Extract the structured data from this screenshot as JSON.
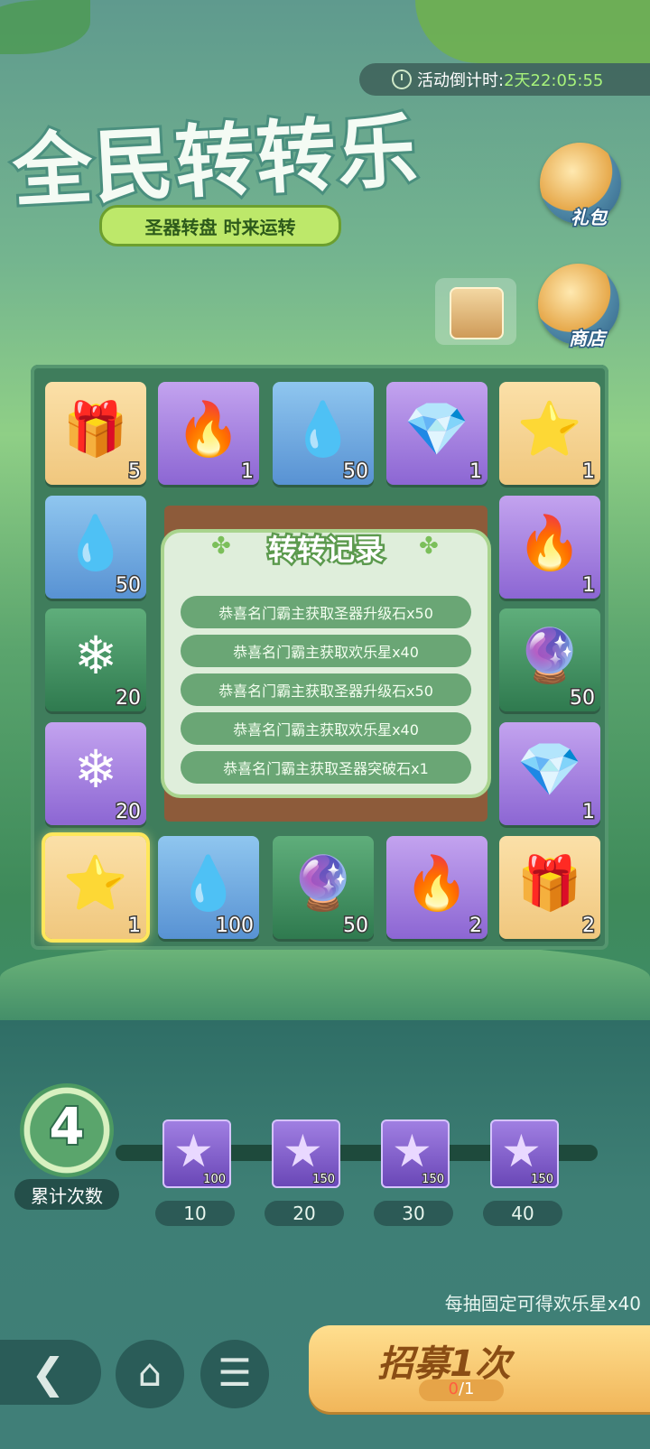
{
  "timer": {
    "label": "活动倒计时:",
    "value": "2天22:05:55",
    "icon": "clock-icon"
  },
  "title": {
    "main": "全民转转乐",
    "subtitle": "圣器转盘 时来运转"
  },
  "side_buttons": {
    "gift": "礼包",
    "shop": "商店"
  },
  "board": {
    "cells": [
      {
        "item": "chest",
        "icon": "🎁",
        "qty": "5",
        "color": "orange"
      },
      {
        "item": "fire-orb",
        "icon": "🔥",
        "qty": "1",
        "color": "purple"
      },
      {
        "item": "water-orb",
        "icon": "💧",
        "qty": "50",
        "color": "blue"
      },
      {
        "item": "red-crystal",
        "icon": "💎",
        "qty": "1",
        "color": "purple"
      },
      {
        "item": "star",
        "icon": "⭐",
        "qty": "1",
        "color": "orange"
      },
      {
        "item": "water-orb",
        "icon": "💧",
        "qty": "50",
        "color": "blue"
      },
      {
        "item": "fire-orb",
        "icon": "🔥",
        "qty": "1",
        "color": "purple"
      },
      {
        "item": "ice-shard",
        "icon": "❄",
        "qty": "20",
        "color": "green"
      },
      {
        "item": "purple-crystal",
        "icon": "🔮",
        "qty": "50",
        "color": "green"
      },
      {
        "item": "ice-shard",
        "icon": "❄",
        "qty": "20",
        "color": "purple"
      },
      {
        "item": "red-crystal",
        "icon": "💎",
        "qty": "1",
        "color": "purple"
      },
      {
        "item": "star",
        "icon": "⭐",
        "qty": "1",
        "color": "orange"
      },
      {
        "item": "water-orb",
        "icon": "💧",
        "qty": "100",
        "color": "blue"
      },
      {
        "item": "purple-crystal",
        "icon": "🔮",
        "qty": "50",
        "color": "green"
      },
      {
        "item": "fire-orb",
        "icon": "🔥",
        "qty": "2",
        "color": "purple"
      },
      {
        "item": "chest",
        "icon": "🎁",
        "qty": "2",
        "color": "orange"
      }
    ]
  },
  "record": {
    "title": "转转记录",
    "rows": [
      "恭喜名门霸主获取圣器升级石x50",
      "恭喜名门霸主获取欢乐星x40",
      "恭喜名门霸主获取圣器升级石x50",
      "恭喜名门霸主获取欢乐星x40",
      "恭喜名门霸主获取圣器突破石x1"
    ]
  },
  "progress": {
    "count": "4",
    "count_label": "累计次数",
    "milestones": [
      {
        "at": "10",
        "reward_qty": "100"
      },
      {
        "at": "20",
        "reward_qty": "150"
      },
      {
        "at": "30",
        "reward_qty": "150"
      },
      {
        "at": "40",
        "reward_qty": "150"
      }
    ]
  },
  "note": "每抽固定可得欢乐星x40",
  "recruit": {
    "label": "招募1次",
    "cost_current": "0",
    "cost_total": "/1"
  },
  "nav": {
    "back_icon": "back-arrow-icon",
    "home_icon": "home-icon",
    "menu_icon": "list-menu-icon"
  }
}
